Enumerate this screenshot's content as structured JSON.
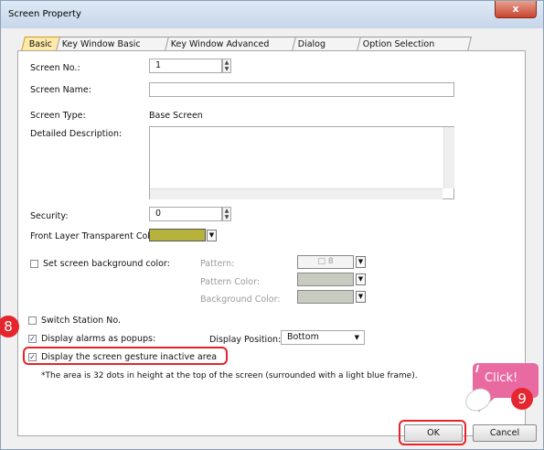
{
  "window": {
    "title": "Screen Property",
    "close_glyph": "x"
  },
  "tabs": [
    {
      "label": "Basic",
      "active": true
    },
    {
      "label": "Key Window Basic Setting"
    },
    {
      "label": "Key Window Advanced Setting"
    },
    {
      "label": "Dialog Window"
    },
    {
      "label": "Option Selection Window"
    }
  ],
  "form": {
    "screen_no_label": "Screen No.:",
    "screen_no_value": "1",
    "screen_name_label": "Screen Name:",
    "screen_name_value": "",
    "screen_type_label": "Screen Type:",
    "screen_type_value": "Base Screen",
    "description_label": "Detailed Description:",
    "description_value": "",
    "security_label": "Security:",
    "security_value": "0",
    "front_layer_label": "Front Layer Transparent Color:",
    "front_layer_color": "#b7b23c",
    "bg_color_label": "Set screen background color:",
    "bg_color_checked": false,
    "pattern_label": "Pattern:",
    "pattern_value": "8",
    "pattern_color_label": "Pattern Color:",
    "background_color_label": "Background Color:",
    "switch_station_label": "Switch Station No.",
    "switch_station_checked": false,
    "popups_label": "Display alarms as popups:",
    "popups_checked": true,
    "display_position_label": "Display Position:",
    "display_position_value": "Bottom",
    "gesture_label": "Display the screen gesture inactive area",
    "gesture_checked": true,
    "note": "*The area is 32 dots in height at the top of the screen (surrounded with a light blue frame)."
  },
  "buttons": {
    "ok": "OK",
    "cancel": "Cancel"
  },
  "annotations": {
    "step8": "8",
    "step9": "9",
    "click_label": "Click!"
  },
  "colors": {
    "highlight": "#e8222c",
    "callout": "#e96aa0",
    "active_tab": "#ffe9a8"
  }
}
